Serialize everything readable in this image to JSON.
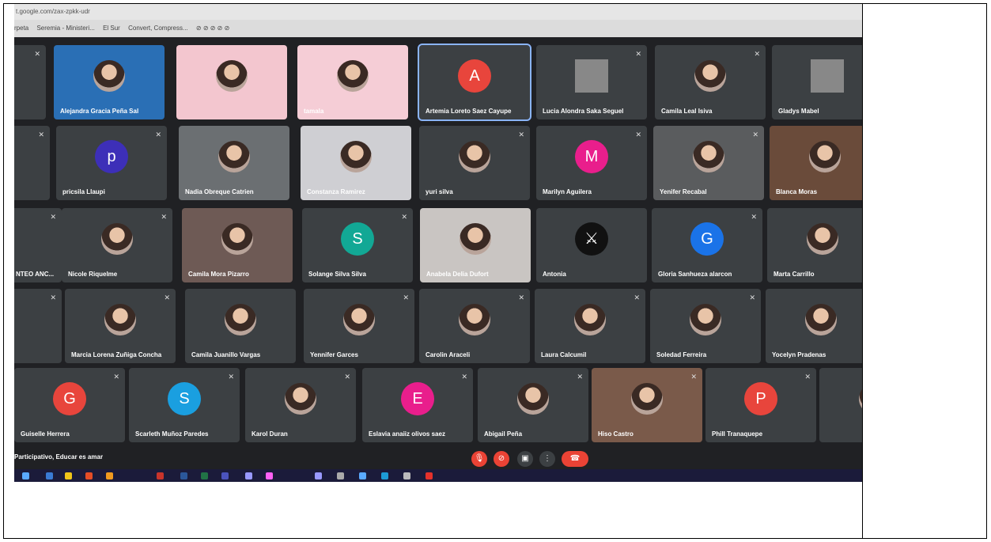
{
  "browser": {
    "url": "t.google.com/zax-zpkk-udr",
    "bookmarks": [
      "rpeta",
      "Seremia - Ministeri...",
      "El Sur",
      "Convert, Compress..."
    ]
  },
  "meeting": {
    "name": "Participativo, Educar es amar"
  },
  "participants": {
    "p1": "Alejandra Gracia Peña Sal",
    "p2": "",
    "p3": "tamala",
    "p4": "Artemia Loreto Saez Cayupe",
    "p5": "Lucia Alondra Saka Seguel",
    "p6": "Camila Leal Isiva",
    "p7": "Gladys Mabel",
    "p8": "pricsila Llaupi",
    "p9": "Nadia Obreque Catrien",
    "p10": "Constanza Ramirez",
    "p11": "yuri silva",
    "p12": "Marilyn Aguilera",
    "p13": "Yenifer Recabal",
    "p14": "Blanca Moras",
    "p15": "NTEO ANC...",
    "p16": "Nicole Riquelme",
    "p17": "Camila Mora Pizarro",
    "p18": "Solange Silva Silva",
    "p19": "Anabela Delia Dufort",
    "p20": "Antonia",
    "p21": "Gloria Sanhueza alarcon",
    "p22": "Marta Carrillo",
    "p23": "Marcia Lorena Zuñiga Concha",
    "p24": "Camila Juanillo Vargas",
    "p25": "Yennifer Garces",
    "p26": "Carolin Araceli",
    "p27": "Laura Calcumil",
    "p28": "Soledad Ferreira",
    "p29": "Yocelyn Pradenas",
    "p30": "Guiselle Herrera",
    "p31": "Scarleth Muñoz Paredes",
    "p32": "Karol Duran",
    "p33": "Eslavia anaiiz olivos saez",
    "p34": "Abigail Peña",
    "p35": "Hiso Castro",
    "p36": "Phill Tranaquepe"
  },
  "initials": {
    "artemia": "A",
    "pricsila": "p",
    "marilyn": "M",
    "solange": "S",
    "gloria": "G",
    "guiselle": "G",
    "scarleth": "S",
    "eslavia": "E",
    "phill": "P"
  },
  "colors": {
    "tile_bg": "#3c4043",
    "stage_bg": "#202124",
    "avatar_red": "#e8453c",
    "avatar_pink": "#e91e8c",
    "avatar_blue": "#1a73e8",
    "avatar_cyan": "#1a9fe0",
    "avatar_teal": "#12a895",
    "avatar_purple": "#3d2fb8",
    "end_call": "#ea4335"
  },
  "icons": [
    "mic-off-icon",
    "camera-off-icon",
    "present-icon",
    "more-icon",
    "end-call-icon"
  ]
}
